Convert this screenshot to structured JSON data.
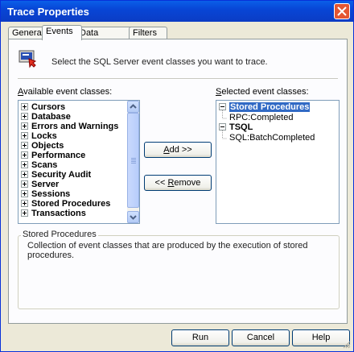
{
  "window": {
    "title": "Trace Properties"
  },
  "tabs": [
    {
      "label": "General"
    },
    {
      "label": "Events"
    },
    {
      "label": "Data Columns"
    },
    {
      "label": "Filters"
    }
  ],
  "active_tab": "Events",
  "intro_text": "Select the SQL Server event classes you want to trace.",
  "available": {
    "label_underlined": "A",
    "label_rest": "vailable event classes:",
    "items": [
      "Cursors",
      "Database",
      "Errors and Warnings",
      "Locks",
      "Objects",
      "Performance",
      "Scans",
      "Security Audit",
      "Server",
      "Sessions",
      "Stored Procedures",
      "Transactions"
    ]
  },
  "selected": {
    "label_underlined": "S",
    "label_rest": "elected event classes:",
    "groups": [
      {
        "name": "Stored Procedures",
        "children": [
          "RPC:Completed"
        ]
      },
      {
        "name": "TSQL",
        "children": [
          "SQL:BatchCompleted"
        ]
      }
    ]
  },
  "buttons": {
    "add_underlined": "A",
    "add_rest": "dd >>",
    "remove_prefix": "<< ",
    "remove_underlined": "R",
    "remove_rest": "emove",
    "run": "Run",
    "cancel": "Cancel",
    "help": "Help"
  },
  "description": {
    "title": "Stored Procedures",
    "text": "Collection of event classes that are produced by the execution of stored procedures."
  },
  "colors": {
    "titlebar": "#0846d6",
    "selection": "#316ac5",
    "close": "#e45632"
  }
}
